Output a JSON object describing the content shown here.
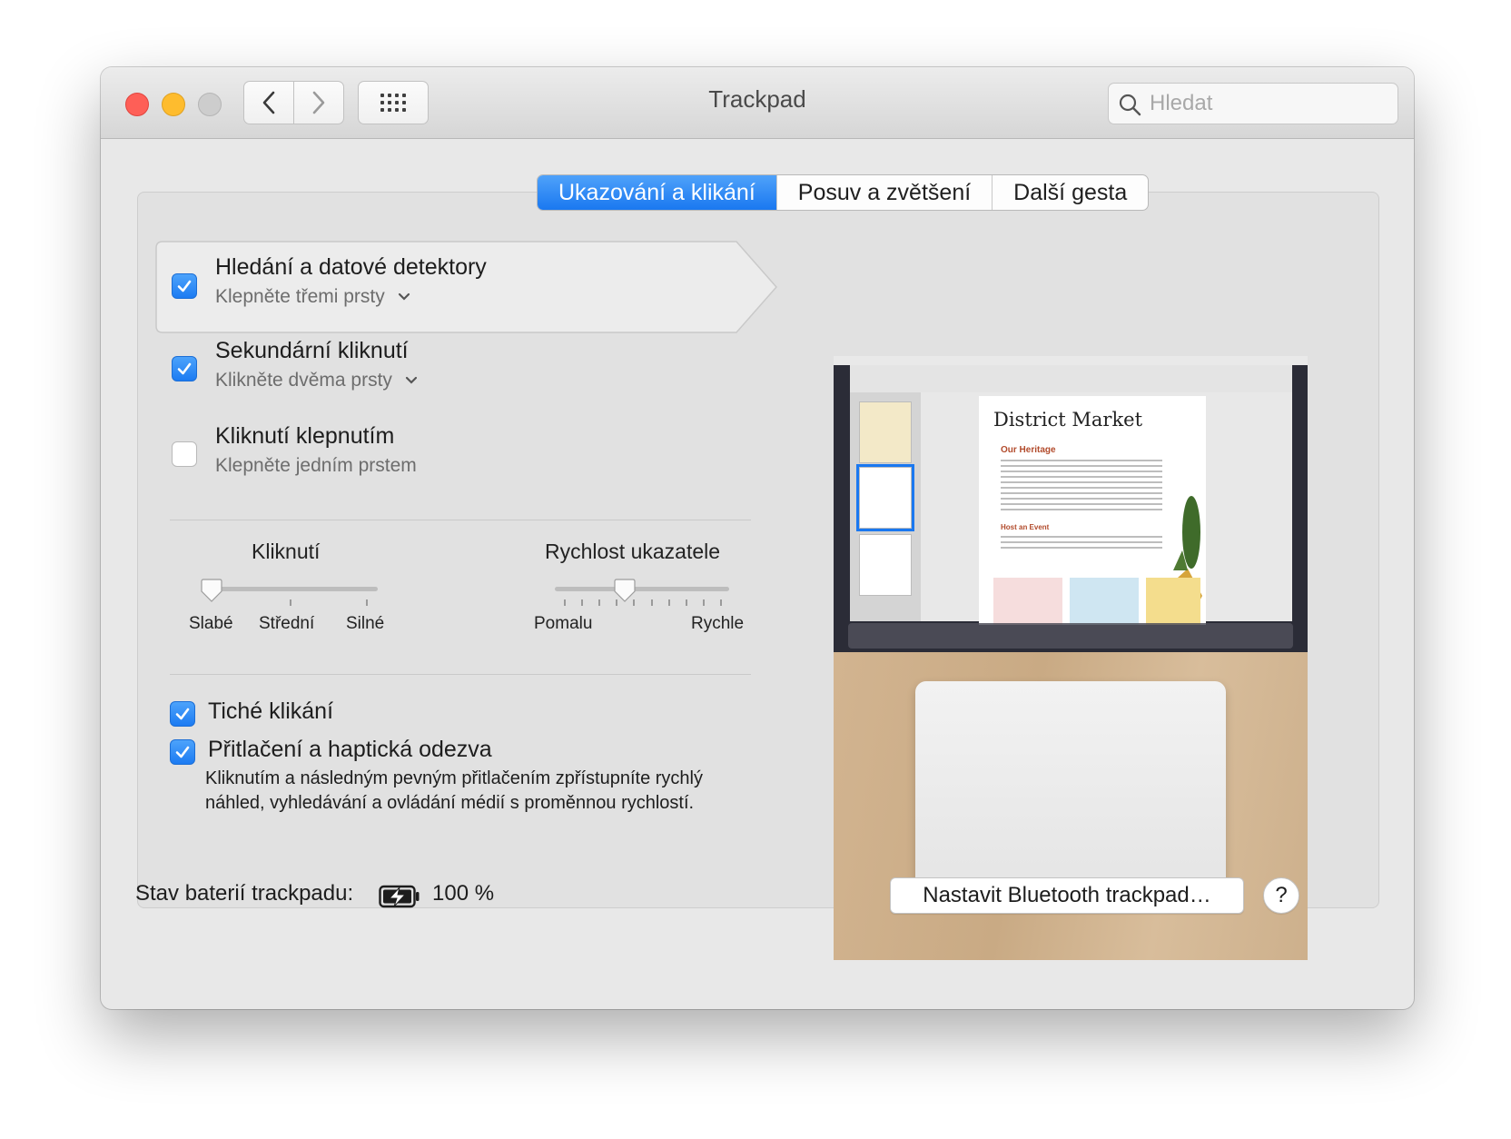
{
  "window": {
    "title": "Trackpad"
  },
  "search": {
    "placeholder": "Hledat"
  },
  "tabs": [
    {
      "label": "Ukazování a klikání",
      "active": true
    },
    {
      "label": "Posuv a zvětšení",
      "active": false
    },
    {
      "label": "Další gesta",
      "active": false
    }
  ],
  "options": [
    {
      "label": "Hledání a datové detektory",
      "sub": "Klepněte třemi prsty",
      "checked": true,
      "has_dropdown": true,
      "selected": true
    },
    {
      "label": "Sekundární kliknutí",
      "sub": "Klikněte dvěma prsty",
      "checked": true,
      "has_dropdown": true,
      "selected": false
    },
    {
      "label": "Kliknutí klepnutím",
      "sub": "Klepněte jedním prstem",
      "checked": false,
      "has_dropdown": false,
      "selected": false
    }
  ],
  "click_slider": {
    "title": "Kliknutí",
    "labels": [
      "Slabé",
      "Střední",
      "Silné"
    ],
    "value_index": 0
  },
  "speed_slider": {
    "title": "Rychlost ukazatele",
    "min_label": "Pomalu",
    "max_label": "Rychle",
    "value_fraction": 0.4
  },
  "bottom_options": [
    {
      "label": "Tiché klikání",
      "checked": true
    },
    {
      "label": "Přitlačení a haptická odezva",
      "checked": true
    }
  ],
  "force_click_description": "Kliknutím a následným pevným přitlačením zpřístupníte rychlý náhled, vyhledávání a ovládání médií s proměnnou rychlostí.",
  "preview": {
    "doc_title": "District Market",
    "heading1": "Our Heritage",
    "heading2": "Host an Event"
  },
  "battery": {
    "label": "Stav baterií trackpadu:",
    "value": "100 %",
    "icon": "battery-charging-icon"
  },
  "bluetooth_button": "Nastavit Bluetooth trackpad…",
  "help_button": "?",
  "colors": {
    "accent": "#1a78f0",
    "close": "#fe5f57",
    "minimize": "#febc2e"
  }
}
